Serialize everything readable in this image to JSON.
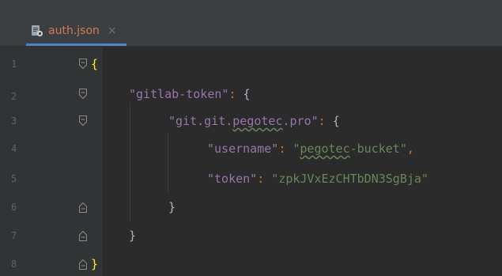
{
  "tab": {
    "filename": "auth.json",
    "close_glyph": "×",
    "icon": "json-file-icon"
  },
  "lines": [
    {
      "num": "1"
    },
    {
      "num": "2"
    },
    {
      "num": "3"
    },
    {
      "num": "4"
    },
    {
      "num": "5"
    },
    {
      "num": "6"
    },
    {
      "num": "7"
    },
    {
      "num": "8"
    }
  ],
  "code": {
    "l1_open": "{",
    "l2_key": "\"gitlab-token\"",
    "l2_colon": ":",
    "l2_open": "{",
    "l3_key_prefix": "\"git.git.",
    "l3_key_typo": "pegotec",
    "l3_key_suffix": ".pro\"",
    "l3_colon": ":",
    "l3_open": "{",
    "l4_key": "\"username\"",
    "l4_colon": ":",
    "l4_val_prefix": "\"",
    "l4_val_typo": "pegotec",
    "l4_val_suffix": "-bucket\"",
    "l4_comma": ",",
    "l5_key": "\"token\"",
    "l5_colon": ":",
    "l5_val": "\"zpkJVxEzCHTbDN3SgBja\"",
    "l6_close": "}",
    "l7_close": "}",
    "l8_close": "}"
  },
  "colors": {
    "background": "#2b2b2b",
    "gutter": "#313335",
    "tab_text": "#d27b53",
    "tab_underline": "#4a88c7",
    "key": "#9876aa",
    "string": "#6a8759",
    "punctuation": "#cc7832",
    "matched_brace": "#ffef28"
  }
}
